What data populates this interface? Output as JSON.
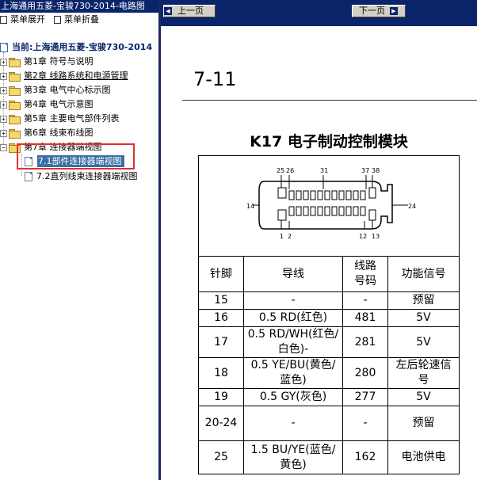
{
  "window_title": "上海通用五菱-宝骏730-2014-电路图",
  "toolbar": {
    "expand_label": "菜单展开",
    "collapse_label": "菜单折叠"
  },
  "tree": {
    "current_label": "当前:上海通用五菱-宝骏730-2014",
    "chapters": [
      "第1章 符号与说明",
      "第2章 线路系统和电源管理",
      "第3章 电气中心标示图",
      "第4章 电气示意图",
      "第5章 主要电气部件列表",
      "第6章 线束布线图",
      "第7章 连接器端视图"
    ],
    "sub_items": [
      "7.1部件连接器端视图",
      "7.2直列线束连接器端视图"
    ]
  },
  "nav": {
    "prev_label": "上一页",
    "next_label": "下一页"
  },
  "doc": {
    "page_number": "7-11",
    "title": "K17 电子制动控制模块",
    "pin_labels": {
      "p25": "25",
      "p26": "26",
      "p31": "31",
      "p37": "37",
      "p38": "38",
      "p14": "14",
      "p24": "24",
      "p1": "1",
      "p2": "2",
      "p12": "12",
      "p13": "13"
    },
    "table": {
      "headers": [
        "针脚",
        "导线",
        "线路\n号码",
        "功能信号"
      ],
      "rows": [
        [
          "15",
          "-",
          "-",
          "预留"
        ],
        [
          "16",
          "0.5 RD(红色)",
          "481",
          "5V"
        ],
        [
          "17",
          "0.5 RD/WH(红色/白色)-",
          "281",
          "5V"
        ],
        [
          "18",
          "0.5 YE/BU(黄色/蓝色)",
          "280",
          "左后轮速信号"
        ],
        [
          "19",
          "0.5 GY(灰色)",
          "277",
          "5V"
        ],
        [
          "20-24",
          "-",
          "-",
          "预留"
        ],
        [
          "25",
          "1.5 BU/YE(蓝色/黄色)",
          "162",
          "电池供电"
        ]
      ]
    }
  },
  "colors": {
    "title_bar": "#0a246a",
    "highlight_box": "#e03030",
    "selection": "#3a6ea5"
  }
}
